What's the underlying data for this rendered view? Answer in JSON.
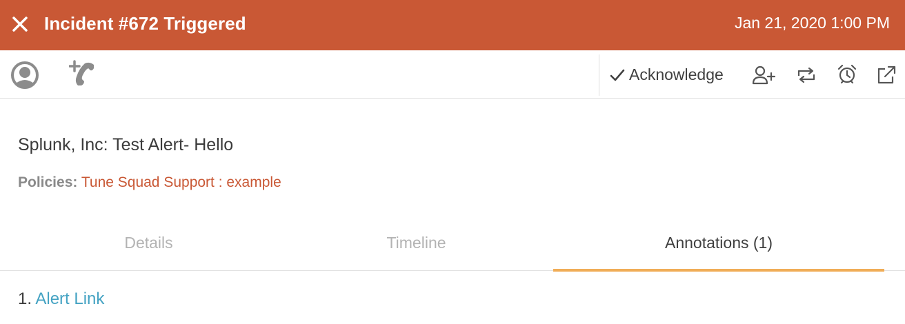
{
  "header": {
    "title": "Incident #672 Triggered",
    "timestamp": "Jan 21, 2020 1:00 PM",
    "background_color": "#c95835"
  },
  "toolbar": {
    "left_icons": [
      "avatar-icon",
      "add-call-icon"
    ],
    "acknowledge_label": "Acknowledge",
    "right_icons": [
      "add-user-icon",
      "reroute-icon",
      "snooze-alarm-icon",
      "external-link-icon"
    ]
  },
  "incident": {
    "summary": "Splunk, Inc: Test Alert- Hello",
    "policies_label": "Policies:",
    "policies_value": "Tune Squad Support : example"
  },
  "tabs": [
    {
      "label": "Details",
      "active": false
    },
    {
      "label": "Timeline",
      "active": false
    },
    {
      "label": "Annotations (1)",
      "active": true
    }
  ],
  "annotations": [
    {
      "number": "1.",
      "label": "Alert Link"
    }
  ],
  "colors": {
    "accent": "#c95835",
    "tab_indicator": "#f0ad57",
    "link": "#45a3c3"
  }
}
